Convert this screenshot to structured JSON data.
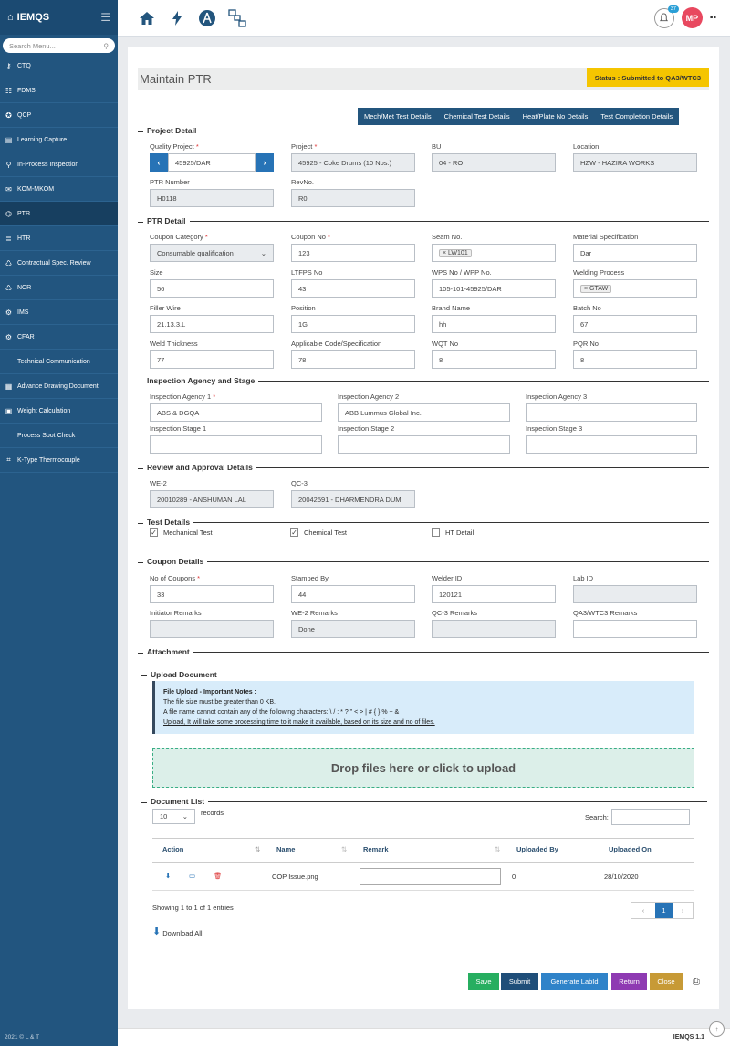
{
  "app": {
    "name": "IEMQS",
    "version": "IEMQS 1.1",
    "copyright": "2021 © L & T"
  },
  "sidebar": {
    "search_placeholder": "Search Menu...",
    "items": [
      {
        "label": "CTQ",
        "icon": "key-icon"
      },
      {
        "label": "FDMS",
        "icon": "users-icon"
      },
      {
        "label": "QCP",
        "icon": "medal-icon"
      },
      {
        "label": "Learning Capture",
        "icon": "book-icon"
      },
      {
        "label": "In-Process Inspection",
        "icon": "search-icon"
      },
      {
        "label": "KOM-MKOM",
        "icon": "chat-icon"
      },
      {
        "label": "PTR",
        "icon": "sitemap-icon"
      },
      {
        "label": "HTR",
        "icon": "list-icon"
      },
      {
        "label": "Contractual Spec. Review",
        "icon": "recycle-icon"
      },
      {
        "label": "NCR",
        "icon": "recycle-icon"
      },
      {
        "label": "IMS",
        "icon": "gear-icon"
      },
      {
        "label": "CFAR",
        "icon": "gear-icon"
      },
      {
        "label": "Technical Communication",
        "icon": "none"
      },
      {
        "label": "Advance Drawing Document",
        "icon": "doc-icon"
      },
      {
        "label": "Weight Calculation",
        "icon": "calc-icon"
      },
      {
        "label": "Process Spot Check",
        "icon": "none"
      },
      {
        "label": "K-Type Thermocouple",
        "icon": "crop-icon"
      }
    ],
    "active": "PTR"
  },
  "topbar": {
    "notification_count": "37",
    "user_initials": "MP"
  },
  "page": {
    "title": "Maintain PTR",
    "status": "Status : Submitted to QA3/WTC3"
  },
  "tabs": [
    "Mech/Met Test Details",
    "Chemical Test Details",
    "Heat/Plate No Details",
    "Test Completion Details"
  ],
  "project_detail": {
    "title": "Project Detail",
    "quality_project": {
      "label": "Quality Project",
      "value": "45925/DAR"
    },
    "project": {
      "label": "Project",
      "value": "45925 - Coke Drums (10 Nos.)"
    },
    "bu": {
      "label": "BU",
      "value": "04 - RO"
    },
    "location": {
      "label": "Location",
      "value": "HZW - HAZIRA WORKS"
    },
    "ptr_number": {
      "label": "PTR Number",
      "value": "H0118"
    },
    "rev_no": {
      "label": "RevNo.",
      "value": "R0"
    }
  },
  "ptr_detail": {
    "title": "PTR Detail",
    "coupon_category": {
      "label": "Coupon Category",
      "value": "Consumable qualification"
    },
    "coupon_no": {
      "label": "Coupon No",
      "value": "123"
    },
    "seam_no": {
      "label": "Seam No.",
      "value": "LW101"
    },
    "material_spec": {
      "label": "Material Specification",
      "value": "Dar"
    },
    "size": {
      "label": "Size",
      "value": "56"
    },
    "ltfps_no": {
      "label": "LTFPS No",
      "value": "43"
    },
    "wps_no": {
      "label": "WPS No / WPP No.",
      "value": "105-101-45925/DAR"
    },
    "welding_process": {
      "label": "Welding Process",
      "value": "GTAW"
    },
    "filler_wire": {
      "label": "Filler Wire",
      "value": "21.13.3.L"
    },
    "position": {
      "label": "Position",
      "value": "1G"
    },
    "brand_name": {
      "label": "Brand Name",
      "value": "hh"
    },
    "batch_no": {
      "label": "Batch No",
      "value": "67"
    },
    "weld_thickness": {
      "label": "Weld Thickness",
      "value": "77"
    },
    "applicable_code": {
      "label": "Applicable Code/Specification",
      "value": "78"
    },
    "wqt_no": {
      "label": "WQT No",
      "value": "8"
    },
    "pqr_no": {
      "label": "PQR No",
      "value": "8"
    }
  },
  "inspection": {
    "title": "Inspection Agency and Stage",
    "agency1": {
      "label": "Inspection Agency 1",
      "value": "ABS & DGQA"
    },
    "agency2": {
      "label": "Inspection Agency 2",
      "value": "ABB Lummus Global Inc."
    },
    "agency3": {
      "label": "Inspection Agency 3",
      "value": ""
    },
    "stage1": {
      "label": "Inspection Stage 1",
      "value": ""
    },
    "stage2": {
      "label": "Inspection Stage 2",
      "value": ""
    },
    "stage3": {
      "label": "Inspection Stage 3",
      "value": ""
    }
  },
  "review": {
    "title": "Review and Approval Details",
    "we2": {
      "label": "WE-2",
      "value": "20010289 - ANSHUMAN LAL"
    },
    "qc3": {
      "label": "QC-3",
      "value": "20042591 - DHARMENDRA DUM"
    }
  },
  "test_details": {
    "title": "Test Details",
    "mechanical": {
      "label": "Mechanical Test",
      "checked": true
    },
    "chemical": {
      "label": "Chemical Test",
      "checked": true
    },
    "ht": {
      "label": "HT Detail",
      "checked": false
    }
  },
  "coupon": {
    "title": "Coupon Details",
    "no_of_coupons": {
      "label": "No of Coupons",
      "value": "33"
    },
    "stamped_by": {
      "label": "Stamped By",
      "value": "44"
    },
    "welder_id": {
      "label": "Welder ID",
      "value": "120121"
    },
    "lab_id": {
      "label": "Lab ID",
      "value": ""
    },
    "initiator_remarks": {
      "label": "Initiator Remarks",
      "value": ""
    },
    "we2_remarks": {
      "label": "WE-2 Remarks",
      "value": "Done"
    },
    "qc3_remarks": {
      "label": "QC-3 Remarks",
      "value": ""
    },
    "qa3_remarks": {
      "label": "QA3/WTC3 Remarks",
      "value": ""
    }
  },
  "attachment": {
    "title": "Attachment",
    "upload_title": "Upload Document",
    "notes_title": "File Upload - Important Notes :",
    "note1": "The file size must be greater than 0 KB.",
    "note2": "A file name cannot contain any of the following characters: \\ / : * ? \" < > | # { } % ~ &",
    "note3": "Upload, It will take some processing time to it make it available, based on its size and no of files.",
    "drop_text": "Drop files here or click to upload"
  },
  "document_list": {
    "title": "Document List",
    "page_size": "10",
    "records_label": "records",
    "search_label": "Search:",
    "columns": [
      "Action",
      "Name",
      "Remark",
      "Uploaded By",
      "Uploaded On"
    ],
    "rows": [
      {
        "name": "COP Issue.png",
        "remark": "",
        "uploaded_by": "0",
        "uploaded_on": "28/10/2020"
      }
    ],
    "info": "Showing 1 to 1 of 1 entries",
    "page": "1",
    "prev": "‹",
    "next": "›",
    "download_all": "Download All"
  },
  "actions": {
    "save": "Save",
    "submit": "Submit",
    "generate": "Generate LabId",
    "return": "Return",
    "close": "Close"
  },
  "colors": {
    "sidebar": "#22557f",
    "save": "#27ae60",
    "submit": "#1f4e79",
    "generate": "#2f83c9",
    "return": "#8e3ab2",
    "close": "#c79a36",
    "status": "#f5c500"
  }
}
